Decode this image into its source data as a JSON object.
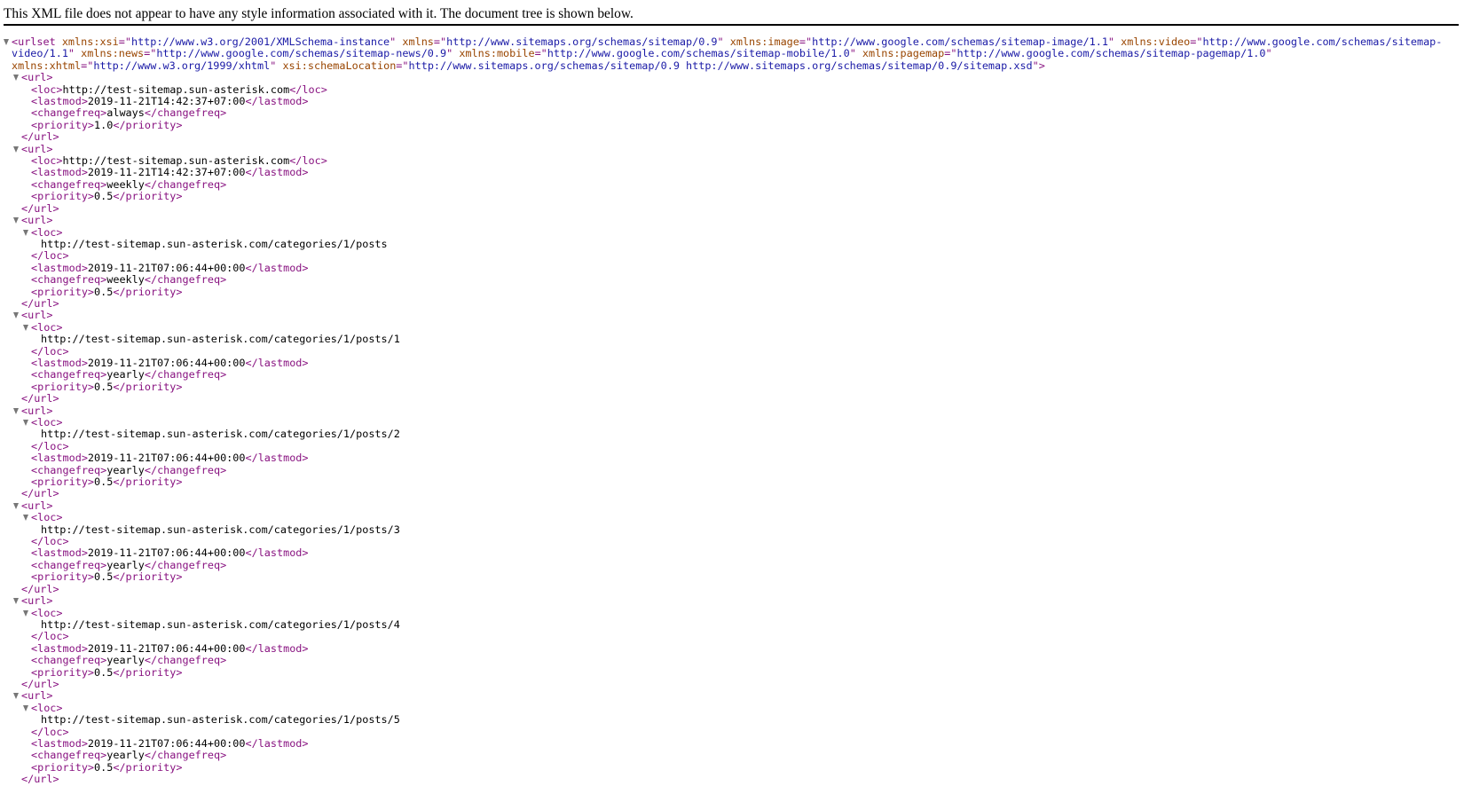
{
  "info_header": "This XML file does not appear to have any style information associated with it. The document tree is shown below.",
  "colors": {
    "tag": "#881280",
    "attr_name": "#994500",
    "attr_value": "#1a1aa6",
    "text": "#000000",
    "toggle": "#777777"
  },
  "root": {
    "tag": "urlset",
    "attributes": [
      {
        "name": "xmlns:xsi",
        "value": "http://www.w3.org/2001/XMLSchema-instance"
      },
      {
        "name": "xmlns",
        "value": "http://www.sitemaps.org/schemas/sitemap/0.9"
      },
      {
        "name": "xmlns:image",
        "value": "http://www.google.com/schemas/sitemap-image/1.1"
      },
      {
        "name": "xmlns:video",
        "value": "http://www.google.com/schemas/sitemap-video/1.1"
      },
      {
        "name": "xmlns:news",
        "value": "http://www.google.com/schemas/sitemap-news/0.9"
      },
      {
        "name": "xmlns:mobile",
        "value": "http://www.google.com/schemas/sitemap-mobile/1.0"
      },
      {
        "name": "xmlns:pagemap",
        "value": "http://www.google.com/schemas/sitemap-pagemap/1.0"
      },
      {
        "name": "xmlns:xhtml",
        "value": "http://www.w3.org/1999/xhtml"
      },
      {
        "name": "xsi:schemaLocation",
        "value": "http://www.sitemaps.org/schemas/sitemap/0.9 http://www.sitemaps.org/schemas/sitemap/0.9/sitemap.xsd"
      }
    ],
    "header_lines": [
      [
        {
          "t": "tag",
          "v": "<urlset "
        },
        {
          "t": "attr",
          "v": "xmlns:xsi"
        },
        {
          "t": "tag",
          "v": "=\""
        },
        {
          "t": "aval",
          "v": "http://www.w3.org/2001/XMLSchema-instance"
        },
        {
          "t": "tag",
          "v": "\" "
        },
        {
          "t": "attr",
          "v": "xmlns"
        },
        {
          "t": "tag",
          "v": "=\""
        },
        {
          "t": "aval",
          "v": "http://www.sitemaps.org/schemas/sitemap/0.9"
        },
        {
          "t": "tag",
          "v": "\" "
        },
        {
          "t": "attr",
          "v": "xmlns:image"
        },
        {
          "t": "tag",
          "v": "=\""
        },
        {
          "t": "aval",
          "v": "http://www.google.com/schemas/sitemap-image/1.1"
        },
        {
          "t": "tag",
          "v": "\" "
        },
        {
          "t": "attr",
          "v": "xmlns:video"
        },
        {
          "t": "tag",
          "v": "=\""
        },
        {
          "t": "aval",
          "v": "http://www.google.com/schemas/sitemap-"
        }
      ],
      [
        {
          "t": "aval",
          "v": "video/1.1"
        },
        {
          "t": "tag",
          "v": "\" "
        },
        {
          "t": "attr",
          "v": "xmlns:news"
        },
        {
          "t": "tag",
          "v": "=\""
        },
        {
          "t": "aval",
          "v": "http://www.google.com/schemas/sitemap-news/0.9"
        },
        {
          "t": "tag",
          "v": "\" "
        },
        {
          "t": "attr",
          "v": "xmlns:mobile"
        },
        {
          "t": "tag",
          "v": "=\""
        },
        {
          "t": "aval",
          "v": "http://www.google.com/schemas/sitemap-mobile/1.0"
        },
        {
          "t": "tag",
          "v": "\" "
        },
        {
          "t": "attr",
          "v": "xmlns:pagemap"
        },
        {
          "t": "tag",
          "v": "=\""
        },
        {
          "t": "aval",
          "v": "http://www.google.com/schemas/sitemap-pagemap/1.0"
        },
        {
          "t": "tag",
          "v": "\""
        }
      ],
      [
        {
          "t": "attr",
          "v": "xmlns:xhtml"
        },
        {
          "t": "tag",
          "v": "=\""
        },
        {
          "t": "aval",
          "v": "http://www.w3.org/1999/xhtml"
        },
        {
          "t": "tag",
          "v": "\" "
        },
        {
          "t": "attr",
          "v": "xsi:schemaLocation"
        },
        {
          "t": "tag",
          "v": "=\""
        },
        {
          "t": "aval",
          "v": "http://www.sitemaps.org/schemas/sitemap/0.9 http://www.sitemaps.org/schemas/sitemap/0.9/sitemap.xsd"
        },
        {
          "t": "tag",
          "v": "\">"
        }
      ]
    ]
  },
  "urls": [
    {
      "loc": "http://test-sitemap.sun-asterisk.com",
      "loc_expanded": false,
      "lastmod": "2019-11-21T14:42:37+07:00",
      "changefreq": "always",
      "priority": "1.0"
    },
    {
      "loc": "http://test-sitemap.sun-asterisk.com",
      "loc_expanded": false,
      "lastmod": "2019-11-21T14:42:37+07:00",
      "changefreq": "weekly",
      "priority": "0.5"
    },
    {
      "loc": "http://test-sitemap.sun-asterisk.com/categories/1/posts",
      "loc_expanded": true,
      "lastmod": "2019-11-21T07:06:44+00:00",
      "changefreq": "weekly",
      "priority": "0.5"
    },
    {
      "loc": "http://test-sitemap.sun-asterisk.com/categories/1/posts/1",
      "loc_expanded": true,
      "lastmod": "2019-11-21T07:06:44+00:00",
      "changefreq": "yearly",
      "priority": "0.5"
    },
    {
      "loc": "http://test-sitemap.sun-asterisk.com/categories/1/posts/2",
      "loc_expanded": true,
      "lastmod": "2019-11-21T07:06:44+00:00",
      "changefreq": "yearly",
      "priority": "0.5"
    },
    {
      "loc": "http://test-sitemap.sun-asterisk.com/categories/1/posts/3",
      "loc_expanded": true,
      "lastmod": "2019-11-21T07:06:44+00:00",
      "changefreq": "yearly",
      "priority": "0.5"
    },
    {
      "loc": "http://test-sitemap.sun-asterisk.com/categories/1/posts/4",
      "loc_expanded": true,
      "lastmod": "2019-11-21T07:06:44+00:00",
      "changefreq": "yearly",
      "priority": "0.5"
    },
    {
      "loc": "http://test-sitemap.sun-asterisk.com/categories/1/posts/5",
      "loc_expanded": true,
      "lastmod": "2019-11-21T07:06:44+00:00",
      "changefreq": "yearly",
      "priority": "0.5"
    }
  ]
}
